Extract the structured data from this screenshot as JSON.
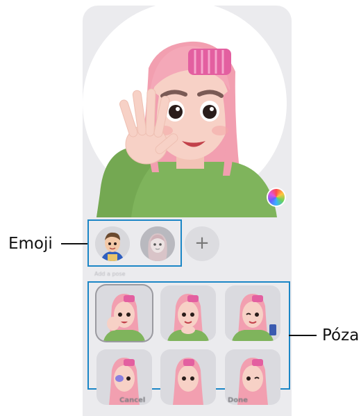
{
  "callouts": {
    "emoji": "Emoji",
    "pose": "Póza"
  },
  "emoji_list": {
    "add_symbol": "+"
  },
  "pose_section": {
    "label": "Add a pose"
  },
  "buttons": {
    "cancel": "Cancel",
    "done": "Done"
  },
  "colors": {
    "highlight_box": "#1b86c6",
    "panel_bg": "#ebebee",
    "skin": "#f7d1c6",
    "hair": "#f29fb0",
    "sweater": "#7fb45c"
  },
  "icons": [
    "color-palette-icon",
    "plus-icon"
  ]
}
